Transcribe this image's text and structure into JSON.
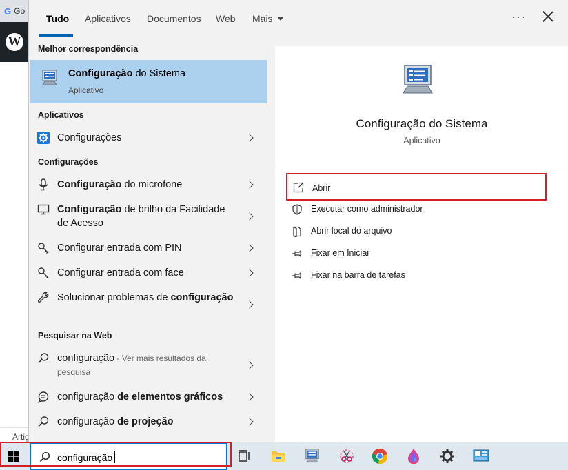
{
  "background": {
    "tab_label": "Go",
    "article_text": "Artig"
  },
  "nav": {
    "tabs": [
      {
        "label": "Tudo",
        "active": true
      },
      {
        "label": "Aplicativos",
        "active": false
      },
      {
        "label": "Documentos",
        "active": false
      },
      {
        "label": "Web",
        "active": false
      },
      {
        "label": "Mais",
        "active": false
      }
    ],
    "more_icon": "ellipsis-icon",
    "close_icon": "close-icon"
  },
  "results": {
    "best_match_header": "Melhor correspondência",
    "best_match": {
      "title_bold": "Configuração",
      "title_rest": " do Sistema",
      "subtitle": "Aplicativo",
      "icon": "system-config-icon"
    },
    "apps_header": "Aplicativos",
    "apps": [
      {
        "text": "Configurações",
        "icon": "gear-icon"
      }
    ],
    "settings_header": "Configurações",
    "settings": [
      {
        "bold": "Configuração",
        "rest": " do microfone",
        "icon": "microphone-icon"
      },
      {
        "bold": "Configuração",
        "rest": " de brilho da Facilidade de Acesso",
        "icon": "monitor-icon"
      },
      {
        "bold": "",
        "rest": "Configurar entrada com PIN",
        "icon": "key-icon"
      },
      {
        "bold": "",
        "rest": "Configurar entrada com face",
        "icon": "key-icon"
      },
      {
        "bold": "configuração",
        "pre": "Solucionar problemas de ",
        "icon": "wrench-icon"
      }
    ],
    "web_header": "Pesquisar na Web",
    "web": [
      {
        "normal": "configuração",
        "hint": " - Ver mais resultados da pesquisa",
        "icon": "search-icon"
      },
      {
        "normal": "configuração ",
        "bold": "de elementos gráficos",
        "icon": "chat-icon"
      },
      {
        "normal": "configuração ",
        "bold": "de projeção",
        "icon": "search-icon"
      }
    ]
  },
  "detail": {
    "title": "Configuração do Sistema",
    "subtitle": "Aplicativo",
    "actions": [
      {
        "label": "Abrir",
        "icon": "open-icon"
      },
      {
        "label": "Executar como administrador",
        "icon": "shield-icon"
      },
      {
        "label": "Abrir local do arquivo",
        "icon": "file-location-icon"
      },
      {
        "label": "Fixar em Iniciar",
        "icon": "pin-icon"
      },
      {
        "label": "Fixar na barra de tarefas",
        "icon": "pin-icon"
      }
    ]
  },
  "taskbar": {
    "search_value": "configuração",
    "apps": [
      "task-view-icon",
      "file-explorer-icon",
      "system-config-icon",
      "snipping-tool-icon",
      "chrome-icon",
      "paint-icon",
      "settings-icon",
      "control-panel-icon"
    ]
  },
  "colors": {
    "accent": "#0078d7",
    "selection": "#acd1ef",
    "highlight_red": "#d0202a"
  }
}
